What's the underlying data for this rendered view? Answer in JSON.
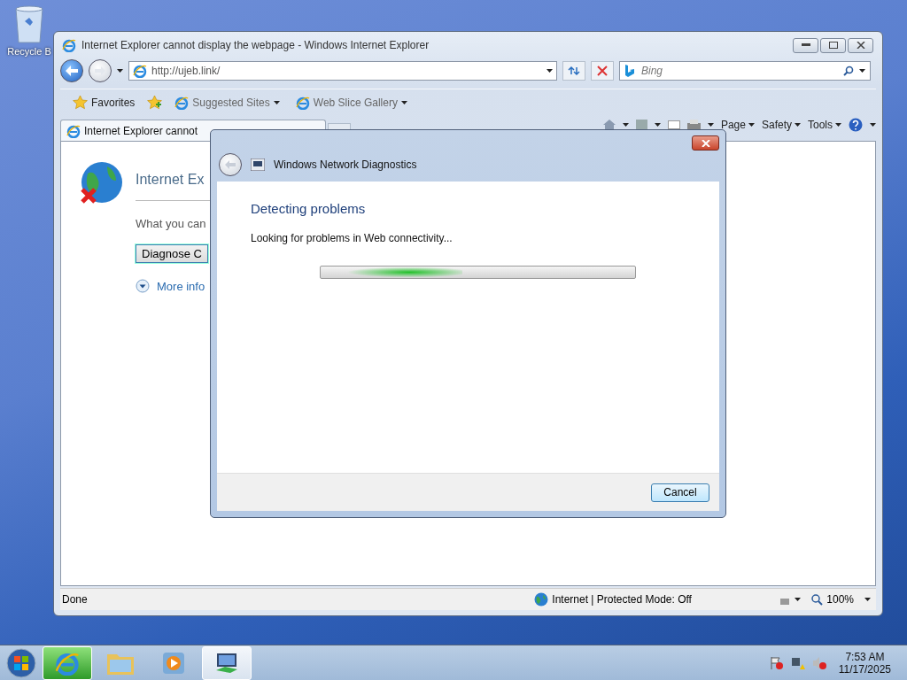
{
  "desktop": {
    "icons": [
      {
        "label": "Recycle B"
      }
    ]
  },
  "ie": {
    "title": "Internet Explorer cannot display the webpage - Windows Internet Explorer",
    "address": "http://ujeb.link/",
    "search": {
      "placeholder": "Bing"
    },
    "favorites_bar": {
      "favorites": "Favorites",
      "links": [
        "Suggested Sites",
        "Web Slice Gallery"
      ]
    },
    "tabs": [
      {
        "label": "Internet Explorer cannot",
        "selected": true
      }
    ],
    "command_bar": [
      "Page",
      "Safety",
      "Tools"
    ],
    "page": {
      "heading": "Internet Ex",
      "prompt": "What you can",
      "button": "Diagnose C",
      "more": "More info"
    },
    "status_bar": {
      "text": "Done",
      "zone": "Internet | Protected Mode: Off",
      "zoom": "100%"
    }
  },
  "dialog": {
    "title": "Windows Network Diagnostics",
    "heading": "Detecting problems",
    "message": "Looking for problems in Web connectivity...",
    "progress": {
      "level": 0.45
    },
    "button": "Cancel"
  },
  "taskbar": {
    "apps": [
      {
        "kind": "browser",
        "selected": true
      },
      {
        "kind": "folder",
        "selected": false
      },
      {
        "kind": "media",
        "selected": false
      },
      {
        "kind": "network",
        "selected": true
      }
    ],
    "clock": {
      "time": "7:53 AM",
      "date": "11/17/2025"
    }
  }
}
